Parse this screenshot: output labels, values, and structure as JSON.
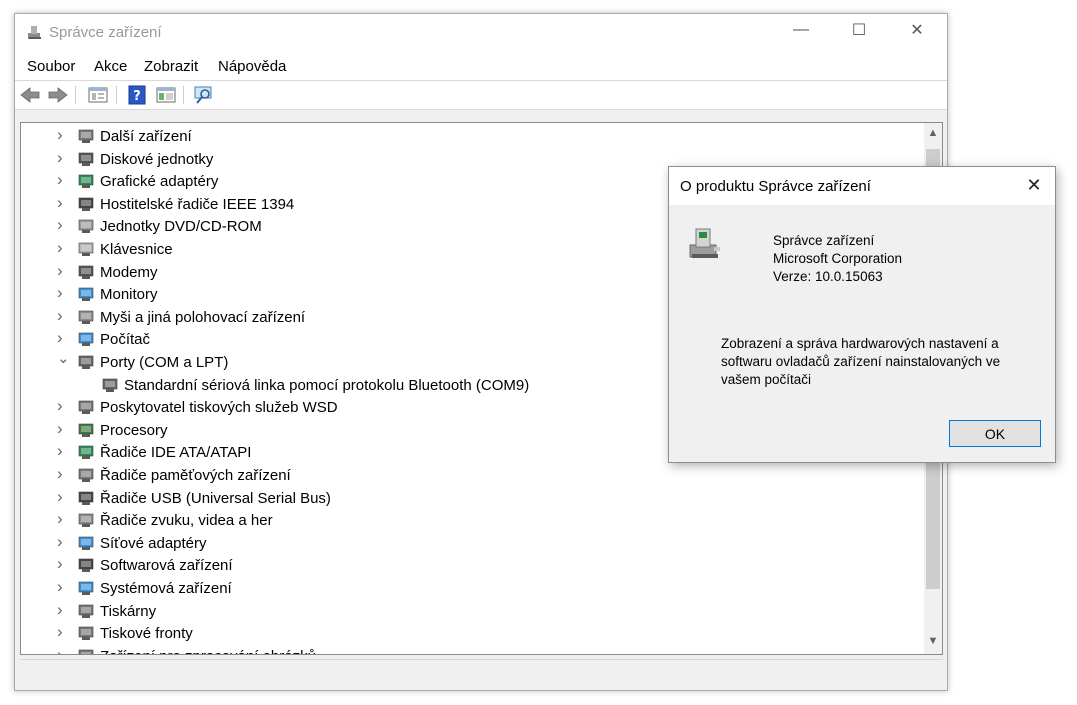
{
  "window": {
    "title": "Správce zařízení",
    "controls": {
      "minimize": "—",
      "maximize": "☐",
      "close": "✕"
    }
  },
  "menu": [
    "Soubor",
    "Akce",
    "Zobrazit",
    "Nápověda"
  ],
  "toolbar_icons": [
    "back-arrow-icon",
    "forward-arrow-icon",
    "properties-icon",
    "help-icon",
    "view-icon",
    "scan-hardware-icon"
  ],
  "tree": {
    "items": [
      {
        "label": "Další zařízení",
        "icon": "unknown-device-icon",
        "expanded": false
      },
      {
        "label": "Diskové jednotky",
        "icon": "disk-drive-icon",
        "expanded": false
      },
      {
        "label": "Grafické adaptéry",
        "icon": "display-adapter-icon",
        "expanded": false
      },
      {
        "label": "Hostitelské řadiče IEEE 1394",
        "icon": "ieee1394-icon",
        "expanded": false
      },
      {
        "label": "Jednotky DVD/CD-ROM",
        "icon": "dvd-drive-icon",
        "expanded": false
      },
      {
        "label": "Klávesnice",
        "icon": "keyboard-icon",
        "expanded": false
      },
      {
        "label": "Modemy",
        "icon": "modem-icon",
        "expanded": false
      },
      {
        "label": "Monitory",
        "icon": "monitor-icon",
        "expanded": false
      },
      {
        "label": "Myši a jiná polohovací zařízení",
        "icon": "mouse-icon",
        "expanded": false
      },
      {
        "label": "Počítač",
        "icon": "computer-icon",
        "expanded": false
      },
      {
        "label": "Porty (COM a LPT)",
        "icon": "port-icon",
        "expanded": true
      },
      {
        "label": "Standardní sériová linka pomocí protokolu Bluetooth (COM9)",
        "icon": "serial-port-icon",
        "child": true
      },
      {
        "label": "Poskytovatel tiskových služeb WSD",
        "icon": "printer-icon",
        "expanded": false
      },
      {
        "label": "Procesory",
        "icon": "processor-icon",
        "expanded": false
      },
      {
        "label": "Řadiče IDE ATA/ATAPI",
        "icon": "ide-controller-icon",
        "expanded": false
      },
      {
        "label": "Řadiče paměťových zařízení",
        "icon": "storage-controller-icon",
        "expanded": false
      },
      {
        "label": "Řadiče USB (Universal Serial Bus)",
        "icon": "usb-icon",
        "expanded": false
      },
      {
        "label": "Řadiče zvuku, videa a her",
        "icon": "speaker-icon",
        "expanded": false
      },
      {
        "label": "Síťové adaptéry",
        "icon": "network-adapter-icon",
        "expanded": false
      },
      {
        "label": "Softwarová zařízení",
        "icon": "software-device-icon",
        "expanded": false
      },
      {
        "label": "Systémová zařízení",
        "icon": "system-device-icon",
        "expanded": false
      },
      {
        "label": "Tiskárny",
        "icon": "printer-icon",
        "expanded": false
      },
      {
        "label": "Tiskové fronty",
        "icon": "print-queue-icon",
        "expanded": false
      },
      {
        "label": "Zařízení pro zpracování obrázků",
        "icon": "imaging-device-icon",
        "expanded": false
      }
    ]
  },
  "dialog": {
    "title": "O produktu Správce zařízení",
    "close": "✕",
    "product_name": "Správce zařízení",
    "company": "Microsoft Corporation",
    "version": "Verze: 10.0.15063",
    "description": "Zobrazení a správa hardwarových nastavení a softwaru ovladačů zařízení nainstalovaných ve vašem počítači",
    "ok_label": "OK"
  },
  "colors": {
    "title_text": "#999999",
    "accent": "#0078d7",
    "window_bg": "#f0f0f0"
  }
}
